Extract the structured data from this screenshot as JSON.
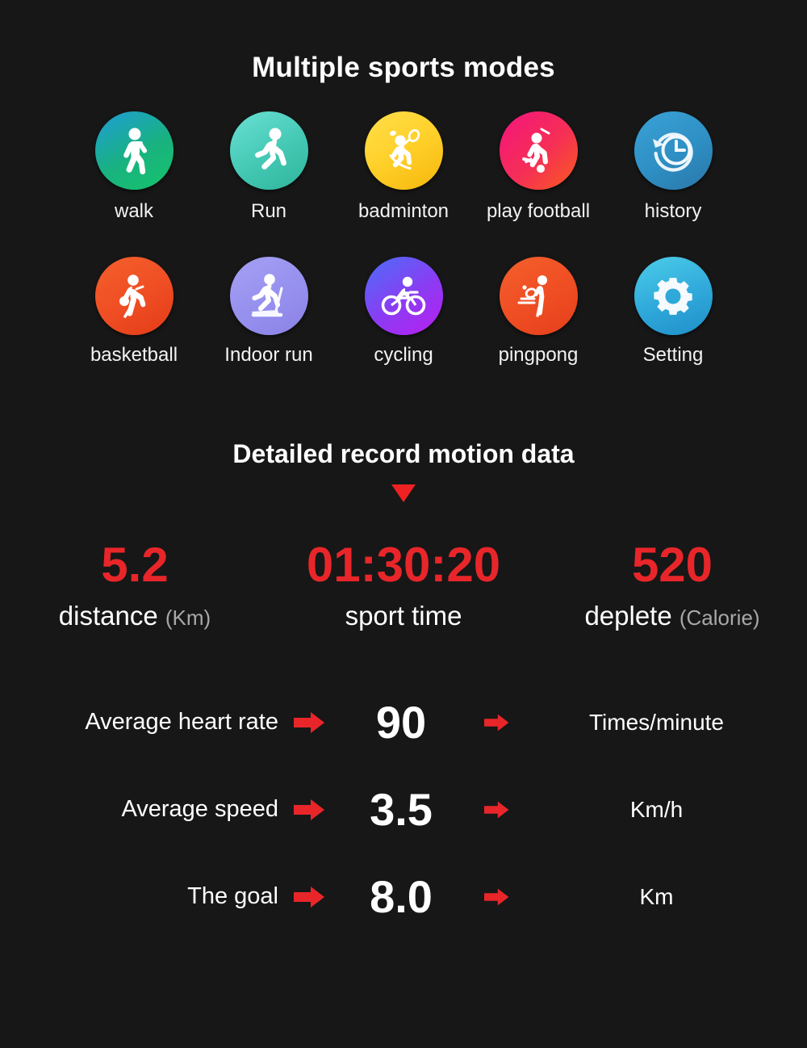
{
  "sports_section": {
    "title": "Multiple sports modes",
    "rows": [
      [
        {
          "label": "walk",
          "icon": "walking-person-icon",
          "color_from": "#1f9dd9",
          "color_to": "#15c46a"
        },
        {
          "label": "Run",
          "icon": "running-person-icon",
          "color_from": "#5fd8cf",
          "color_to": "#32b89e"
        },
        {
          "label": "badminton",
          "icon": "badminton-player-icon",
          "color_from": "#ffd83a",
          "color_to": "#f7ba10"
        },
        {
          "label": "play football",
          "icon": "football-player-icon",
          "color_from": "#f5147f",
          "color_to": "#f94e20"
        },
        {
          "label": "history",
          "icon": "clock-rewind-icon",
          "color_from": "#2f96cd",
          "color_to": "#2b7cae"
        }
      ],
      [
        {
          "label": "basketball",
          "icon": "basketball-player-icon",
          "color_from": "#f15a29",
          "color_to": "#e4401f"
        },
        {
          "label": "Indoor run",
          "icon": "treadmill-runner-icon",
          "color_from": "#9b93ef",
          "color_to": "#8e86e8"
        },
        {
          "label": "cycling",
          "icon": "cyclist-icon",
          "color_from": "#4f6ef7",
          "color_to": "#b520f0"
        },
        {
          "label": "pingpong",
          "icon": "table-tennis-icon",
          "color_from": "#f1592a",
          "color_to": "#e8481f"
        },
        {
          "label": "Setting",
          "icon": "gear-icon",
          "color_from": "#41c6e8",
          "color_to": "#1f94cf"
        }
      ]
    ]
  },
  "detail_section": {
    "title": "Detailed record motion data",
    "arrow_color": "#ee2222",
    "accent_color": "#e8262a",
    "stats": [
      {
        "value": "5.2",
        "label": "distance",
        "unit": "(Km)"
      },
      {
        "value": "01:30:20",
        "label": "sport time",
        "unit": ""
      },
      {
        "value": "520",
        "label": "deplete",
        "unit": "(Calorie)"
      }
    ],
    "metrics": [
      {
        "name": "Average heart rate",
        "value": "90",
        "unit": "Times/minute"
      },
      {
        "name": "Average speed",
        "value": "3.5",
        "unit": "Km/h"
      },
      {
        "name": "The goal",
        "value": "8.0",
        "unit": "Km"
      }
    ]
  }
}
